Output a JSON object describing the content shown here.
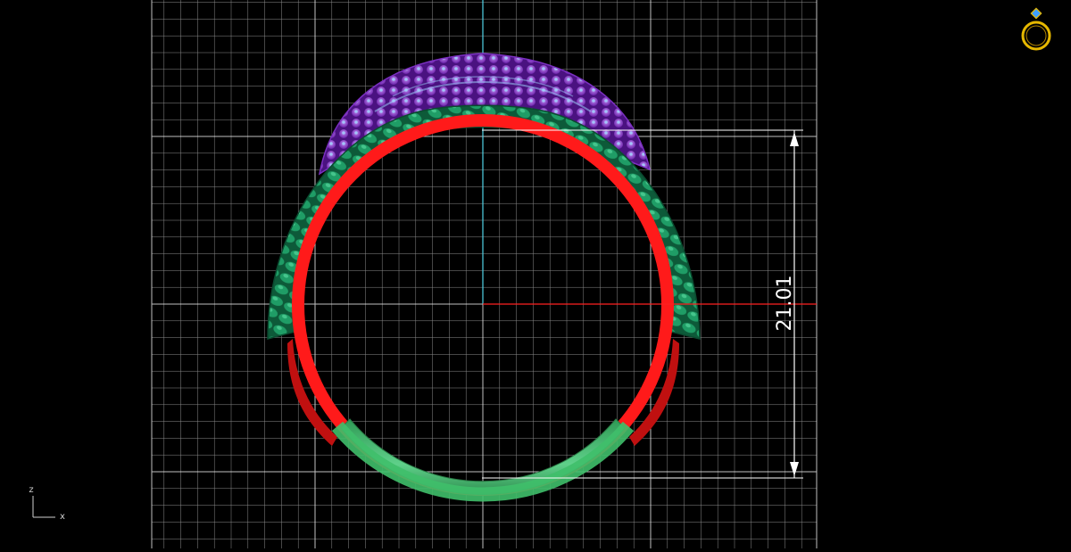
{
  "viewport": {
    "view_name": "front",
    "background": "#000000",
    "grid_color": "#ffffff",
    "x_axis_color": "#ff2020",
    "z_axis_color": "#4fd3e6"
  },
  "model": {
    "shank_color": "#ff1a1a",
    "bottom_band_color": "#40b868",
    "leaf_color": "#1a8f5c",
    "gem_color": "#8a34c8",
    "gem_highlight_color": "#7fc7ff"
  },
  "dimension": {
    "value": "21.01",
    "line_color": "#ffffff"
  },
  "axis_gizmo": {
    "vertical_label": "z",
    "horizontal_label": "x"
  },
  "navigator_icon": {
    "icon": "ring-icon",
    "color": "#e6b800"
  }
}
